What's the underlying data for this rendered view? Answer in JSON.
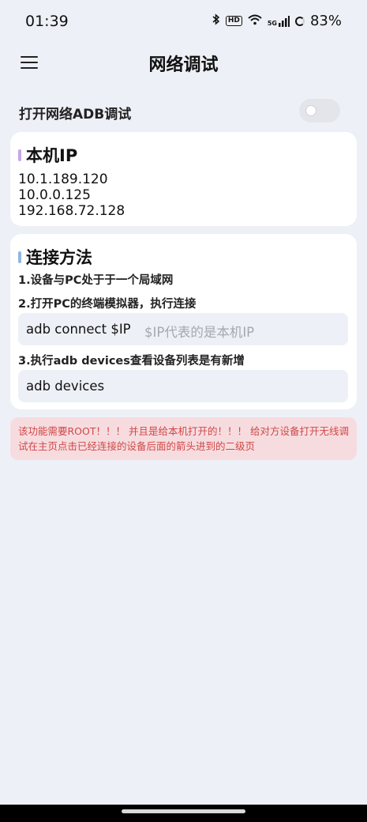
{
  "status_bar": {
    "time": "01:39",
    "icons": [
      "bluetooth-icon",
      "hd-icon",
      "wifi-icon",
      "5g-signal-icon",
      "battery-icon"
    ],
    "hd_label": "HD",
    "net_label": "5G",
    "battery": "83%"
  },
  "header": {
    "title": "网络调试"
  },
  "toggle": {
    "label": "打开网络ADB调试",
    "enabled": false
  },
  "ip_card": {
    "title": "本机IP",
    "accent": "#c8a4e8",
    "ips": [
      "10.1.189.120",
      "10.0.0.125",
      "192.168.72.128"
    ]
  },
  "connect_card": {
    "title": "连接方法",
    "accent": "#8fb7e3",
    "step1": "1.设备与PC处于于一个局域网",
    "step2": "2.打开PC的终端模拟器，执行连接",
    "command1": "adb connect $IP",
    "command1_hint": "$IP代表的是本机IP",
    "step3": "3.执行adb devices查看设备列表是有新增",
    "command2": "adb devices"
  },
  "warning": {
    "text": "该功能需要ROOT！！！ 并且是给本机打开的！！！ 给对方设备打开无线调试在主页点击已经连接的设备后面的箭头进到的二级页",
    "color": "#d04848",
    "background": "#f7dcdf"
  }
}
